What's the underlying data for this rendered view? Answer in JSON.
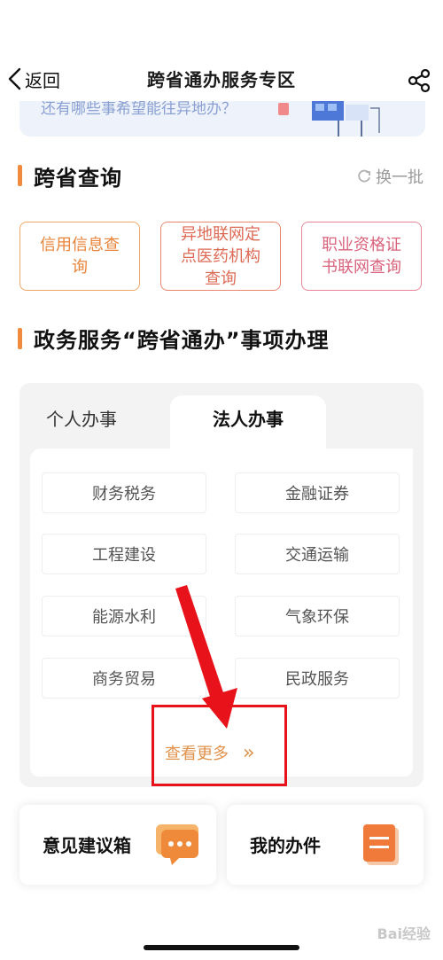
{
  "nav": {
    "back_label": "返回",
    "title": "跨省通办服务专区"
  },
  "banner": {
    "text": "还有哪些事希望能往异地办？"
  },
  "query_section": {
    "title": "跨省查询",
    "refresh_label": "换一批",
    "buttons": [
      {
        "label": "信用信息查询"
      },
      {
        "label": "异地联网定点医药机构查询"
      },
      {
        "label": "职业资格证书联网查询"
      }
    ]
  },
  "affairs_section": {
    "title": "政务服务“跨省通办”事项办理",
    "tabs": [
      {
        "label": "个人办事",
        "active": false
      },
      {
        "label": "法人办事",
        "active": true
      }
    ],
    "categories": [
      {
        "label": "财务税务"
      },
      {
        "label": "金融证券"
      },
      {
        "label": "工程建设"
      },
      {
        "label": "交通运输"
      },
      {
        "label": "能源水利"
      },
      {
        "label": "气象环保"
      },
      {
        "label": "商务贸易"
      },
      {
        "label": "民政服务"
      }
    ],
    "more_label": "查看更多"
  },
  "bottom_cards": [
    {
      "label": "意见建议箱",
      "icon": "chat-bubble-icon"
    },
    {
      "label": "我的办件",
      "icon": "document-icon"
    }
  ],
  "watermark": "Bai经验",
  "colors": {
    "accent_orange": "#f08a3c",
    "highlight_red": "#e8121b"
  }
}
